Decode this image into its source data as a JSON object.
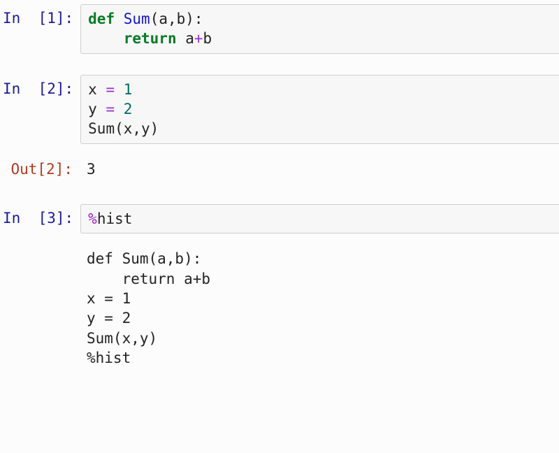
{
  "cells": [
    {
      "prompt": "In  [1]:",
      "kind": "code",
      "tokens": [
        [
          "kw",
          "def"
        ],
        [
          "txt",
          " "
        ],
        [
          "func",
          "Sum"
        ],
        [
          "txt",
          "(a,b):"
        ],
        [
          "txt",
          "\n    "
        ],
        [
          "kw",
          "return"
        ],
        [
          "txt",
          " a"
        ],
        [
          "op",
          "+"
        ],
        [
          "txt",
          "b"
        ]
      ]
    },
    {
      "prompt": "In  [2]:",
      "kind": "code",
      "tokens": [
        [
          "txt",
          "x "
        ],
        [
          "op",
          "="
        ],
        [
          "txt",
          " "
        ],
        [
          "num",
          "1"
        ],
        [
          "txt",
          "\ny "
        ],
        [
          "op",
          "="
        ],
        [
          "txt",
          " "
        ],
        [
          "num",
          "2"
        ],
        [
          "txt",
          "\nSum(x,y)"
        ]
      ]
    },
    {
      "prompt": "Out[2]:",
      "kind": "out",
      "text": "3"
    },
    {
      "prompt": "In  [3]:",
      "kind": "code",
      "tokens": [
        [
          "magic",
          "%"
        ],
        [
          "txt",
          "hist"
        ]
      ]
    },
    {
      "prompt": "",
      "kind": "plain",
      "text": "def Sum(a,b):\n    return a+b\nx = 1\ny = 2\nSum(x,y)\n%hist"
    }
  ]
}
